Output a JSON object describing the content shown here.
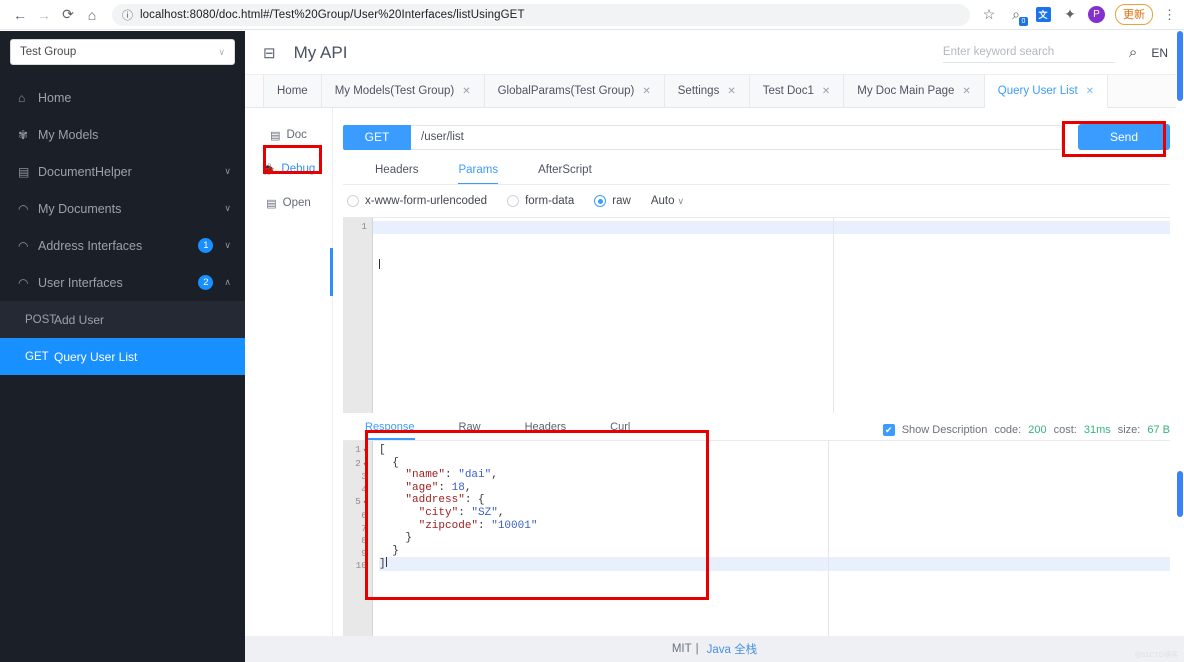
{
  "browser": {
    "url": "localhost:8080/doc.html#/Test%20Group/User%20Interfaces/listUsingGET",
    "back_icon": "←",
    "forward_icon": "→",
    "reload_icon": "⟳",
    "home_icon": "⌂",
    "info_icon": "ⓘ",
    "star_icon": "☆",
    "tab_search_badge": "0",
    "translate_icon": "文",
    "extensions_icon": "✦",
    "profile_initial": "P",
    "update_label": "更新",
    "menu_icon": "⋮"
  },
  "sidebar": {
    "group_selector": {
      "value": "Test Group",
      "caret": "∨"
    },
    "items": [
      {
        "label": "Home",
        "icon": "⌂",
        "badge": "",
        "chevron": ""
      },
      {
        "label": "My Models",
        "icon": "✾",
        "badge": "",
        "chevron": ""
      },
      {
        "label": "DocumentHelper",
        "icon": "▤",
        "badge": "",
        "chevron": "∨"
      },
      {
        "label": "My Documents",
        "icon": "◠",
        "badge": "",
        "chevron": "∨"
      },
      {
        "label": "Address Interfaces",
        "icon": "◠",
        "badge": "1",
        "chevron": "∨"
      },
      {
        "label": "User Interfaces",
        "icon": "◠",
        "badge": "2",
        "chevron": "∧"
      }
    ],
    "sub_items": [
      {
        "method": "POST",
        "name": "Add User",
        "active": false
      },
      {
        "method": "GET",
        "name": "Query User List",
        "active": true
      }
    ]
  },
  "header": {
    "fold_icon": "⊟",
    "title": "My API",
    "search_placeholder": "Enter keyword search",
    "search_value": "",
    "search_icon": "⌕",
    "language": "EN"
  },
  "tabs": [
    {
      "label": "Home",
      "closable": false,
      "active": false
    },
    {
      "label": "My Models(Test Group)",
      "closable": true,
      "active": false
    },
    {
      "label": "GlobalParams(Test Group)",
      "closable": true,
      "active": false
    },
    {
      "label": "Settings",
      "closable": true,
      "active": false
    },
    {
      "label": "Test Doc1",
      "closable": true,
      "active": false
    },
    {
      "label": "My Doc Main Page",
      "closable": true,
      "active": false
    },
    {
      "label": "Query User List",
      "closable": true,
      "active": true
    }
  ],
  "vnav": [
    {
      "label": "Doc",
      "icon": "▤",
      "active": false
    },
    {
      "label": "Debug",
      "icon": "🐞",
      "active": true
    },
    {
      "label": "Open",
      "icon": "▤",
      "active": false
    }
  ],
  "request": {
    "method": "GET",
    "url": "/user/list",
    "send_label": "Send",
    "subtabs": [
      {
        "label": "Headers",
        "active": false
      },
      {
        "label": "Params",
        "active": true
      },
      {
        "label": "AfterScript",
        "active": false
      }
    ],
    "body_types": [
      {
        "label": "x-www-form-urlencoded",
        "selected": false
      },
      {
        "label": "form-data",
        "selected": false
      },
      {
        "label": "raw",
        "selected": true
      }
    ],
    "format_select": {
      "value": "Auto",
      "caret": "∨"
    },
    "body_lines": [
      "1"
    ]
  },
  "response": {
    "tabs": [
      {
        "label": "Response",
        "active": true
      },
      {
        "label": "Raw",
        "active": false
      },
      {
        "label": "Headers",
        "active": false
      },
      {
        "label": "Curl",
        "active": false
      }
    ],
    "show_description_label": "Show Description",
    "show_description_checked": true,
    "check_glyph": "✔",
    "meta": [
      {
        "label": "code:",
        "value": "200"
      },
      {
        "label": "cost:",
        "value": "31ms"
      },
      {
        "label": "size:",
        "value": "67 B"
      }
    ],
    "json_lines": [
      {
        "n": "1",
        "fold": true,
        "indent": 0,
        "tokens": [
          {
            "t": "[",
            "c": "p"
          }
        ]
      },
      {
        "n": "2",
        "fold": true,
        "indent": 1,
        "tokens": [
          {
            "t": "{",
            "c": "p"
          }
        ]
      },
      {
        "n": "3",
        "fold": false,
        "indent": 2,
        "tokens": [
          {
            "t": "\"name\"",
            "c": "k"
          },
          {
            "t": ": ",
            "c": "p"
          },
          {
            "t": "\"dai\"",
            "c": "s"
          },
          {
            "t": ",",
            "c": "p"
          }
        ]
      },
      {
        "n": "4",
        "fold": false,
        "indent": 2,
        "tokens": [
          {
            "t": "\"age\"",
            "c": "k"
          },
          {
            "t": ": ",
            "c": "p"
          },
          {
            "t": "18",
            "c": "n"
          },
          {
            "t": ",",
            "c": "p"
          }
        ]
      },
      {
        "n": "5",
        "fold": true,
        "indent": 2,
        "tokens": [
          {
            "t": "\"address\"",
            "c": "k"
          },
          {
            "t": ": {",
            "c": "p"
          }
        ]
      },
      {
        "n": "6",
        "fold": false,
        "indent": 3,
        "tokens": [
          {
            "t": "\"city\"",
            "c": "k"
          },
          {
            "t": ": ",
            "c": "p"
          },
          {
            "t": "\"SZ\"",
            "c": "s"
          },
          {
            "t": ",",
            "c": "p"
          }
        ]
      },
      {
        "n": "7",
        "fold": false,
        "indent": 3,
        "tokens": [
          {
            "t": "\"zipcode\"",
            "c": "k"
          },
          {
            "t": ": ",
            "c": "p"
          },
          {
            "t": "\"10001\"",
            "c": "s"
          }
        ]
      },
      {
        "n": "8",
        "fold": false,
        "indent": 2,
        "tokens": [
          {
            "t": "}",
            "c": "p"
          }
        ]
      },
      {
        "n": "9",
        "fold": false,
        "indent": 1,
        "tokens": [
          {
            "t": "}",
            "c": "p"
          }
        ]
      },
      {
        "n": "10",
        "fold": false,
        "indent": 0,
        "tokens": [
          {
            "t": "]",
            "c": "p"
          }
        ]
      }
    ],
    "highlight_line": 10
  },
  "footer": {
    "license": "MIT",
    "separator": "|",
    "brand": "Java 全栈",
    "watermark": "@51CTO博客"
  },
  "colors": {
    "accent_blue": "#3b9cff",
    "sidebar_bg": "#1b1f27",
    "annotation_red": "#e60000",
    "status_green": "#36b37e"
  }
}
